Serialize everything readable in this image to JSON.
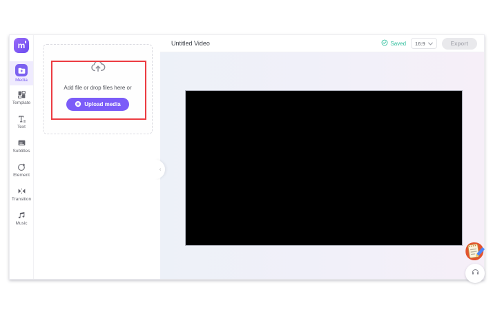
{
  "window": {
    "sidebar": {
      "logo_text": "m",
      "items": [
        {
          "label": "Media",
          "icon": "folder-plus-icon",
          "active": true
        },
        {
          "label": "Template",
          "icon": "template-grid-icon",
          "active": false
        },
        {
          "label": "Text",
          "icon": "text-icon",
          "active": false
        },
        {
          "label": "Subtitles",
          "icon": "subtitles-icon",
          "active": false
        },
        {
          "label": "Element",
          "icon": "element-shapes-icon",
          "active": false
        },
        {
          "label": "Transition",
          "icon": "transition-icon",
          "active": false
        },
        {
          "label": "Music",
          "icon": "music-note-icon",
          "active": false
        }
      ]
    },
    "media_panel": {
      "dropzone_text": "Add file or drop files here or",
      "upload_button_label": "Upload media"
    },
    "topbar": {
      "title": "Untitled Video",
      "saved_label": "Saved",
      "aspect_ratio": "16:9",
      "export_label": "Export"
    },
    "collapse_handle_glyph": "‹"
  },
  "colors": {
    "accent_purple": "#7b5cf8",
    "media_tile_purple": "#7b61f0",
    "saved_green": "#2bbd9b",
    "annotation_red": "#ec3b41",
    "canvas_left": "#edf1f8",
    "canvas_right": "#f6eff8",
    "video_frame": "#000000"
  }
}
